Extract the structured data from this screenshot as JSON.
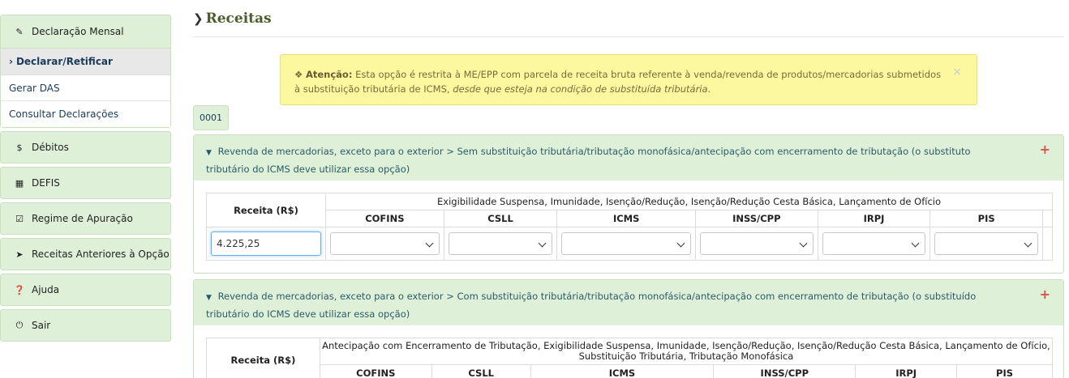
{
  "sidebar": {
    "declaracao_mensal": {
      "label": "Declaração Mensal",
      "icon": "pencil-icon",
      "items": [
        "Declarar/Retificar",
        "Gerar DAS",
        "Consultar Declarações"
      ]
    },
    "debitos": {
      "label": "Débitos",
      "icon": "dollar-icon"
    },
    "defis": {
      "label": "DEFIS",
      "icon": "calendar-icon"
    },
    "regime": {
      "label": "Regime de Apuração",
      "icon": "check-square-icon"
    },
    "receitas_anteriores": {
      "label": "Receitas Anteriores à Opção",
      "icon": "arrow-right-icon"
    },
    "ajuda": {
      "label": "Ajuda",
      "icon": "question-circle-icon"
    },
    "sair": {
      "label": "Sair",
      "icon": "power-icon"
    }
  },
  "page": {
    "title": "Receitas"
  },
  "alert": {
    "label": "Atenção:",
    "text": " Esta opção é restrita à ME/EPP com parcela de receita bruta referente à venda/revenda de produtos/mercadorias submetidos à substituição tributária de ICMS, ",
    "emphasis": "desde que esteja na condição de substituída tributária",
    "end": ".",
    "close": "×"
  },
  "code": "0001",
  "panels": [
    {
      "title": "Revenda de mercadorias, exceto para o exterior > Sem substituição tributária/tributação monofásica/antecipação com encerramento de tributação (o substituto tributário do ICMS deve utilizar essa opção)",
      "receita_header": "Receita (R$)",
      "group_header": "Exigibilidade Suspensa, Imunidade, Isenção/Redução, Isenção/Redução Cesta Básica, Lançamento de Ofício",
      "columns": [
        "COFINS",
        "CSLL",
        "ICMS",
        "INSS/CPP",
        "IRPJ",
        "PIS"
      ],
      "receita_value": "4.225,25"
    },
    {
      "title": "Revenda de mercadorias, exceto para o exterior > Com substituição tributária/tributação monofásica/antecipação com encerramento de tributação (o substituído tributário do ICMS deve utilizar essa opção)",
      "receita_header": "Receita (R$)",
      "group_header": "Antecipação com Encerramento de Tributação, Exigibilidade Suspensa, Imunidade, Isenção/Redução, Isenção/Redução Cesta Básica, Lançamento de Ofício, Substituição Tributária, Tributação Monofásica",
      "columns": [
        "COFINS",
        "CSLL",
        "ICMS",
        "INSS/CPP",
        "IRPJ",
        "PIS"
      ]
    }
  ],
  "plus": "+"
}
